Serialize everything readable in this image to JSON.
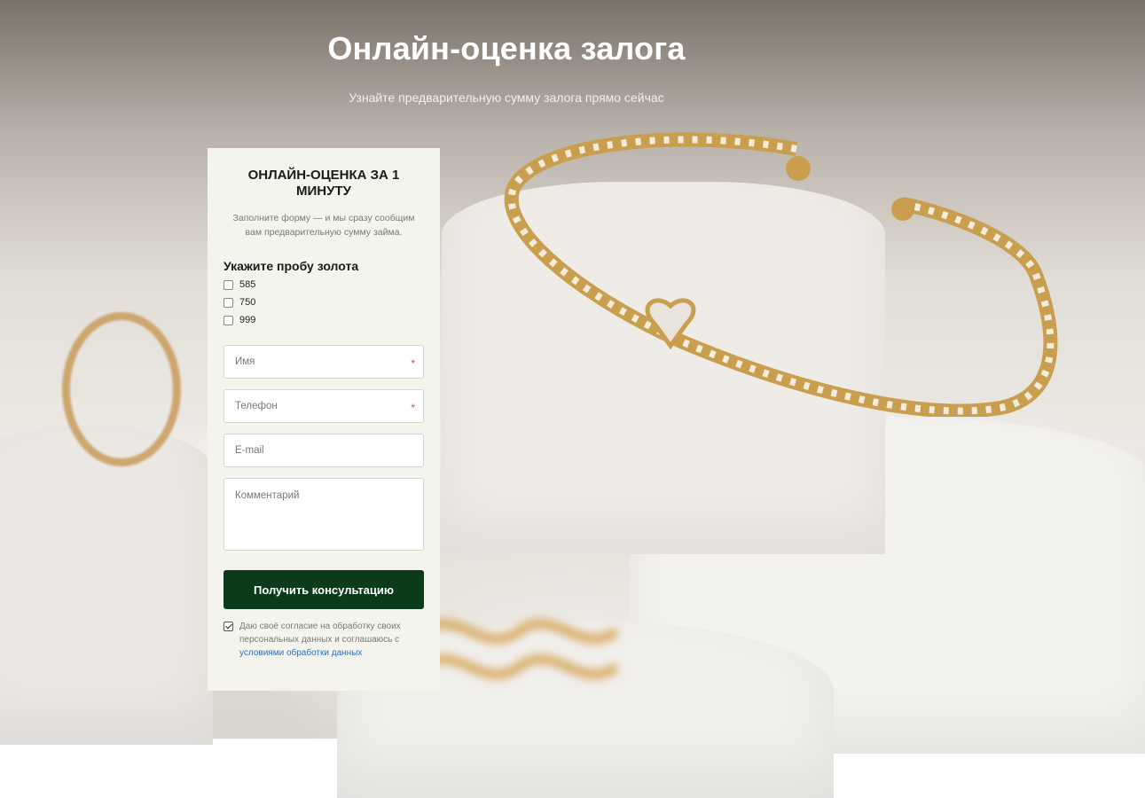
{
  "hero": {
    "title": "Онлайн-оценка залога",
    "subtitle": "Узнайте предварительную сумму залога прямо сейчас"
  },
  "form": {
    "title": "ОНЛАЙН-ОЦЕНКА ЗА 1 МИНУТУ",
    "description": "Заполните форму — и мы сразу сообщим вам предварительную сумму займа.",
    "probe_label": "Укажите пробу золота",
    "probe_options": [
      "585",
      "750",
      "999"
    ],
    "fields": {
      "name_placeholder": "Имя",
      "phone_placeholder": "Телефон",
      "email_placeholder": "E-mail",
      "comment_placeholder": "Комментарий",
      "required_mark": "*"
    },
    "submit_label": "Получить консультацию",
    "consent": {
      "checked": true,
      "text": "Даю своё согласие на обработку своих персональных данных и соглашаюсь с ",
      "link_text": "условиями обработки данных"
    }
  },
  "colors": {
    "button_bg": "#0c3b1c",
    "form_bg": "#f4f3ec",
    "link": "#2a6fb5",
    "required": "#d24a4a",
    "gold": "#caa062"
  }
}
